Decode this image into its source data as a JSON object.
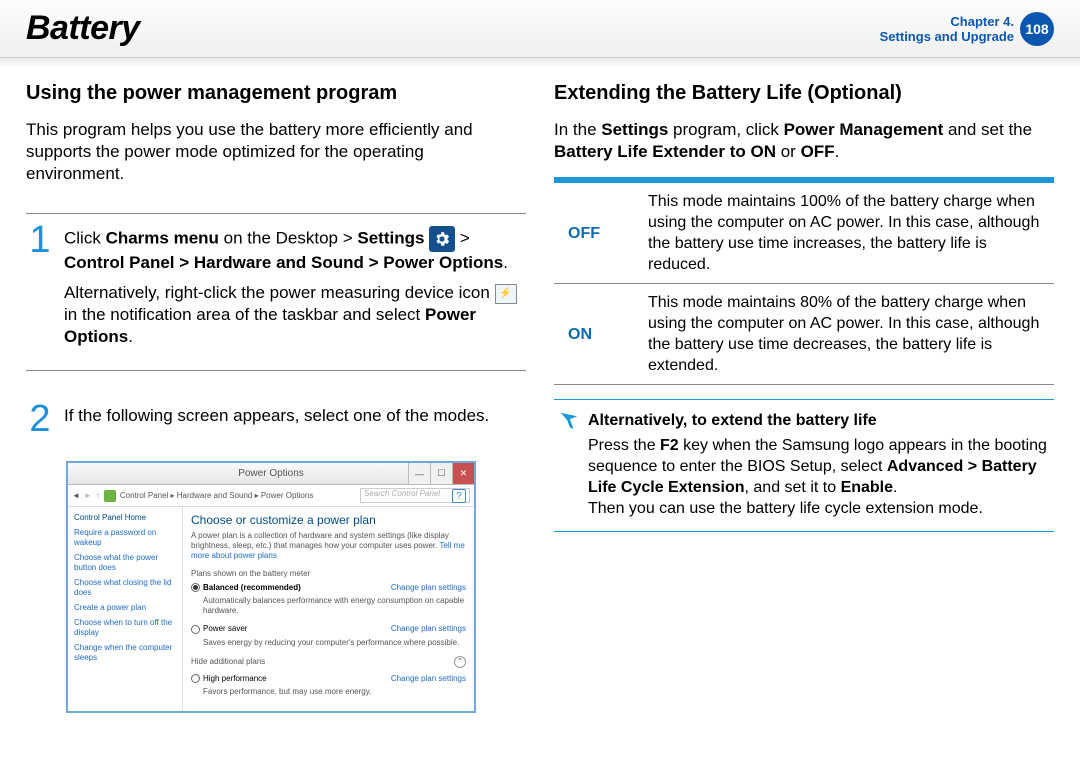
{
  "header": {
    "title": "Battery",
    "chapter_line1": "Chapter 4.",
    "chapter_line2": "Settings and Upgrade",
    "page": "108"
  },
  "left": {
    "heading": "Using the power management program",
    "intro": "This program helps you use the battery more efficiently and supports the power mode optimized for the operating environment.",
    "step1": {
      "num": "1",
      "t1": "Click ",
      "b1": "Charms menu",
      "t2": " on the Desktop > ",
      "b2": "Settings",
      "t3": " > ",
      "b3": "Control Panel > Hardware and Sound > Power Options",
      "t4": ".",
      "alt1": "Alternatively, right-click the power measuring device icon ",
      "alt2": " in the notification area of the taskbar and select ",
      "b4": "Power Options",
      "t5": "."
    },
    "step2": {
      "num": "2",
      "text": "If the following screen appears, select one of the modes."
    }
  },
  "screenshot": {
    "title": "Power Options",
    "breadcrumb": "Control Panel  ▸  Hardware and Sound  ▸  Power Options",
    "search_placeholder": "Search Control Panel",
    "side": {
      "home": "Control Panel Home",
      "links": [
        "Require a password on wakeup",
        "Choose what the power button does",
        "Choose what closing the lid does",
        "Create a power plan",
        "Choose when to turn off the display",
        "Change when the computer sleeps"
      ]
    },
    "main": {
      "heading": "Choose or customize a power plan",
      "desc": "A power plan is a collection of hardware and system settings (like display brightness, sleep, etc.) that manages how your computer uses power. ",
      "desc_link": "Tell me more about power plans",
      "section1": "Plans shown on the battery meter",
      "plan1": {
        "name": "Balanced (recommended)",
        "sub": "Automatically balances performance with energy consumption on capable hardware."
      },
      "plan2": {
        "name": "Power saver",
        "sub": "Saves energy by reducing your computer's performance where possible."
      },
      "hide": "Hide additional plans",
      "plan3": {
        "name": "High performance",
        "sub": "Favors performance, but may use more energy."
      },
      "change": "Change plan settings"
    }
  },
  "right": {
    "heading": "Extending the Battery Life (Optional)",
    "intro_p1": "In the ",
    "intro_b1": "Settings",
    "intro_p2": " program, click ",
    "intro_b2": "Power Management",
    "intro_p3": " and set the ",
    "intro_b3": "Battery Life Extender to ON",
    "intro_p4": " or ",
    "intro_b4": "OFF",
    "intro_p5": ".",
    "table": {
      "off_label": "OFF",
      "off_text": "This mode maintains 100% of the battery charge when using the computer on AC power. In this case, although the battery use time increases, the battery life is reduced.",
      "on_label": "ON",
      "on_text": "This mode maintains 80% of the battery charge when using the computer on AC power. In this case, although the battery use time decreases, the battery life is extended."
    },
    "note": {
      "title": "Alternatively, to extend the battery life",
      "l1a": "Press the ",
      "l1b": "F2",
      "l1c": " key when the Samsung logo appears in the booting sequence to enter the BIOS Setup, select ",
      "l1d": "Advanced > Battery Life Cycle Extension",
      "l1e": ", and set it to ",
      "l1f": "Enable",
      "l1g": ".",
      "l2": "Then you can use the battery life cycle extension mode."
    }
  }
}
